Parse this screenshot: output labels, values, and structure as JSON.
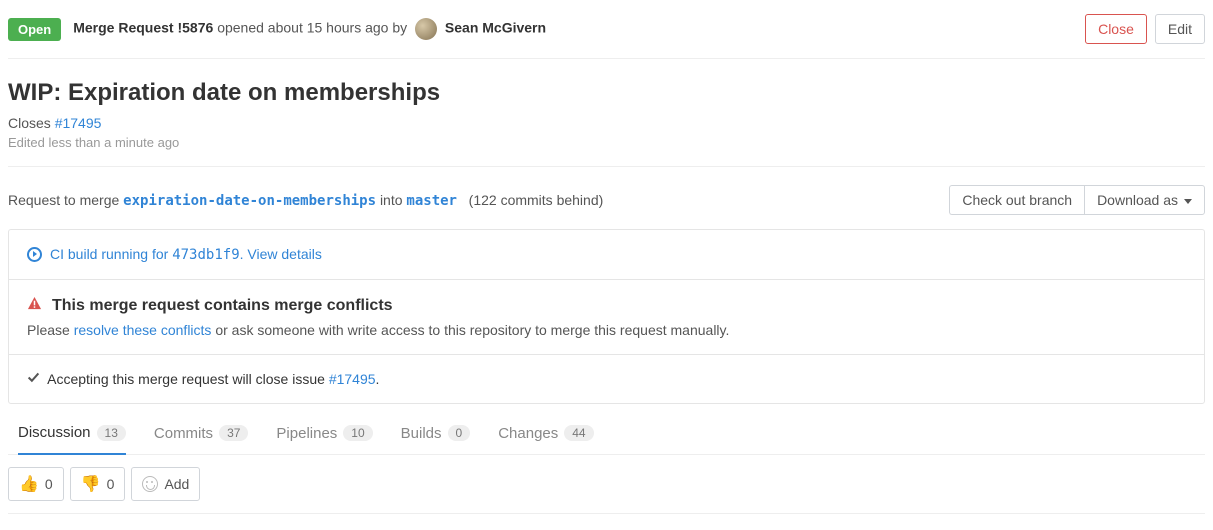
{
  "header": {
    "status": "Open",
    "mr_label": "Merge Request !5876",
    "opened_text": "opened about 15 hours ago by",
    "author": "Sean McGivern",
    "close_btn": "Close",
    "edit_btn": "Edit"
  },
  "title": {
    "text": "WIP: Expiration date on memberships",
    "closes_prefix": "Closes ",
    "closes_issue": "#17495",
    "edited_text": "Edited less than a minute ago"
  },
  "merge": {
    "request_prefix": "Request to merge ",
    "source_branch": "expiration-date-on-memberships",
    "into_text": " into ",
    "target_branch": "master",
    "behind_text": "(122 commits behind)",
    "checkout_btn": "Check out branch",
    "download_btn": "Download as"
  },
  "ci": {
    "text_prefix": "CI build running for ",
    "sha": "473db1f9",
    "view_details": ". View details"
  },
  "conflicts": {
    "title": "This merge request contains merge conflicts",
    "please": "Please ",
    "resolve_link": "resolve these conflicts",
    "or_text": " or ask someone with write access to this repository to merge this request manually."
  },
  "accepting": {
    "prefix": "Accepting this merge request will close issue ",
    "issue": "#17495",
    "suffix": "."
  },
  "tabs": {
    "discussion": {
      "label": "Discussion",
      "count": "13"
    },
    "commits": {
      "label": "Commits",
      "count": "37"
    },
    "pipelines": {
      "label": "Pipelines",
      "count": "10"
    },
    "builds": {
      "label": "Builds",
      "count": "0"
    },
    "changes": {
      "label": "Changes",
      "count": "44"
    }
  },
  "reactions": {
    "thumbs_up_count": "0",
    "thumbs_down_count": "0",
    "add_label": "Add"
  }
}
